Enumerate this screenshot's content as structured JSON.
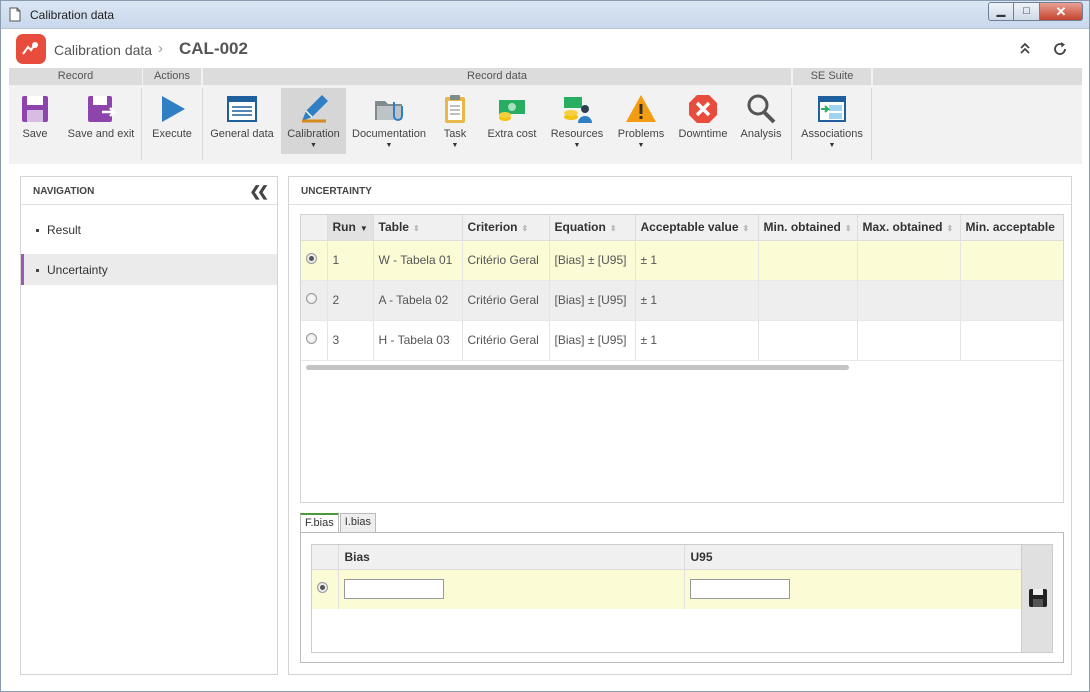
{
  "window": {
    "title": "Calibration data"
  },
  "header": {
    "breadcrumb_root": "Calibration data",
    "breadcrumb_sep": "›",
    "record_id": "CAL-002"
  },
  "ribbon": {
    "groups": {
      "record": "Record",
      "actions": "Actions",
      "record_data": "Record data",
      "se_suite": "SE Suite"
    },
    "buttons": {
      "save": "Save",
      "save_exit": "Save and exit",
      "execute": "Execute",
      "general_data": "General data",
      "calibration": "Calibration",
      "documentation": "Documentation",
      "task": "Task",
      "extra_cost": "Extra cost",
      "resources": "Resources",
      "problems": "Problems",
      "downtime": "Downtime",
      "analysis": "Analysis",
      "associations": "Associations"
    }
  },
  "navigation": {
    "title": "NAVIGATION",
    "items": [
      {
        "label": "Result"
      },
      {
        "label": "Uncertainty"
      }
    ],
    "active": "Uncertainty"
  },
  "main": {
    "title": "UNCERTAINTY",
    "columns": [
      "Run",
      "Table",
      "Criterion",
      "Equation",
      "Acceptable value",
      "Min. obtained",
      "Max. obtained",
      "Min. acceptable"
    ],
    "rows": [
      {
        "run": "1",
        "table": "W - Tabela 01",
        "criterion": "Critério Geral",
        "equation": "[Bias] ± [U95]",
        "acceptable": "± 1",
        "min_obtained": "",
        "max_obtained": "",
        "min_acceptable": ""
      },
      {
        "run": "2",
        "table": "A - Tabela 02",
        "criterion": "Critério Geral",
        "equation": "[Bias] ± [U95]",
        "acceptable": "± 1",
        "min_obtained": "",
        "max_obtained": "",
        "min_acceptable": ""
      },
      {
        "run": "3",
        "table": "H - Tabela 03",
        "criterion": "Critério Geral",
        "equation": "[Bias] ± [U95]",
        "acceptable": "± 1",
        "min_obtained": "",
        "max_obtained": "",
        "min_acceptable": ""
      }
    ],
    "selected_run": "1"
  },
  "subtabs": {
    "tabs": [
      "F.bias",
      "I.bias"
    ],
    "active": "F.bias"
  },
  "subgrid": {
    "columns": [
      "Bias",
      "U95"
    ],
    "bias_value": "",
    "u95_value": ""
  },
  "colors": {
    "accent_purple": "#9a5ab0",
    "logo_red": "#e74c3c",
    "selected_row": "#fbfbd6",
    "tab_green": "#4a9a3a"
  }
}
